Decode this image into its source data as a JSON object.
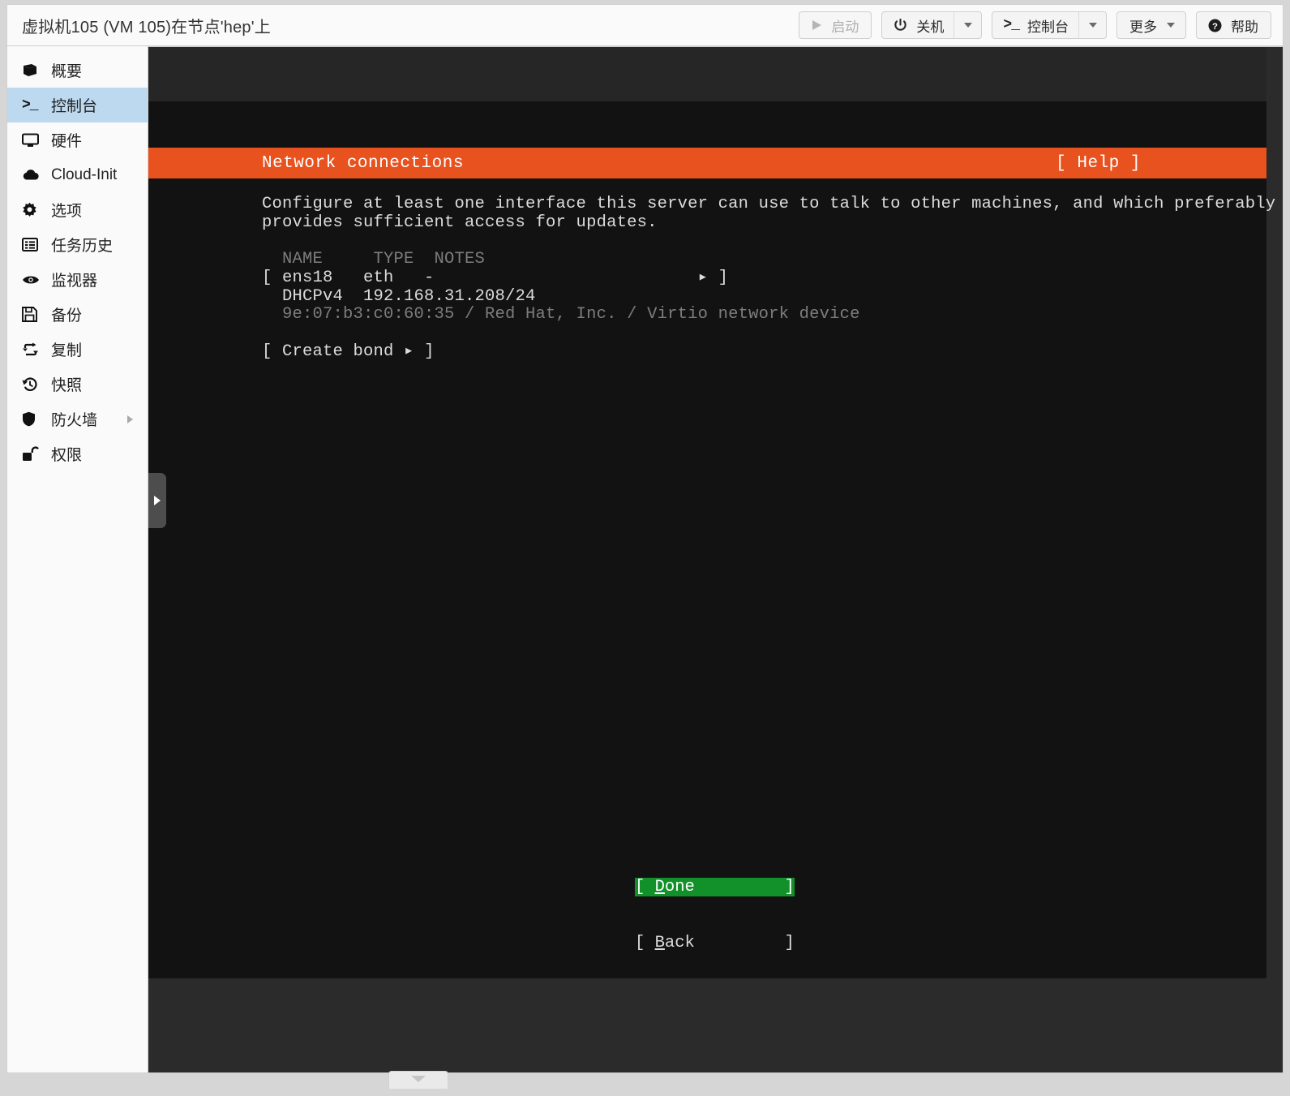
{
  "header": {
    "title": "虚拟机105 (VM 105)在节点'hep'上",
    "buttons": [
      {
        "label": "启动",
        "icon": "play-icon",
        "disabled": true,
        "dropdown": false
      },
      {
        "label": "关机",
        "icon": "power-icon",
        "disabled": false,
        "dropdown": true
      },
      {
        "label": "控制台",
        "icon": "terminal-prompt-icon",
        "disabled": false,
        "dropdown": true
      },
      {
        "label": "更多",
        "icon": "",
        "disabled": false,
        "dropdown": true,
        "plain_caret": true
      },
      {
        "label": "帮助",
        "icon": "question-circle-icon",
        "disabled": false,
        "dropdown": false
      }
    ]
  },
  "sidebar": {
    "items": [
      {
        "label": "概要",
        "icon": "book-icon",
        "active": false,
        "submenu": false
      },
      {
        "label": "控制台",
        "icon": "terminal-prompt-icon",
        "active": true,
        "submenu": false
      },
      {
        "label": "硬件",
        "icon": "monitor-icon",
        "active": false,
        "submenu": false
      },
      {
        "label": "Cloud-Init",
        "icon": "cloud-icon",
        "active": false,
        "submenu": false
      },
      {
        "label": "选项",
        "icon": "gear-icon",
        "active": false,
        "submenu": false
      },
      {
        "label": "任务历史",
        "icon": "list-icon",
        "active": false,
        "submenu": false
      },
      {
        "label": "监视器",
        "icon": "eye-icon",
        "active": false,
        "submenu": false
      },
      {
        "label": "备份",
        "icon": "floppy-disk-icon",
        "active": false,
        "submenu": false
      },
      {
        "label": "复制",
        "icon": "replicate-icon",
        "active": false,
        "submenu": false
      },
      {
        "label": "快照",
        "icon": "history-clock-icon",
        "active": false,
        "submenu": false
      },
      {
        "label": "防火墙",
        "icon": "shield-icon",
        "active": false,
        "submenu": true
      },
      {
        "label": "权限",
        "icon": "unlock-icon",
        "active": false,
        "submenu": false
      }
    ]
  },
  "console": {
    "installer": {
      "header_title": "Network connections",
      "header_help": "[ Help ]",
      "accent_color": "#e8521f",
      "background_color": "#121212",
      "text_color": "#dcdcdc",
      "dim_color": "#7d7d7d",
      "selection_color": "#12912b",
      "description_lines": [
        "Configure at least one interface this server can use to talk to other machines, and which preferably",
        "provides sufficient access for updates."
      ],
      "table_header": "  NAME     TYPE  NOTES",
      "interfaces": [
        {
          "row": "[ ens18   eth   -                          ▸ ]",
          "detail": "  DHCPv4  192.168.31.208/24",
          "hardware": "  9e:07:b3:c0:60:35 / Red Hat, Inc. / Virtio network device",
          "name": "ens18",
          "type": "eth",
          "notes": "-",
          "dhcp_version": "DHCPv4",
          "address": "192.168.31.208/24",
          "mac": "9e:07:b3:c0:60:35",
          "vendor": "Red Hat, Inc.",
          "model": "Virtio network device"
        }
      ],
      "create_bond": "[ Create bond ▸ ]",
      "buttons": [
        {
          "open": "[ ",
          "accel": "D",
          "rest": "one",
          "pad": "         ",
          "close": "]",
          "selected": true,
          "label": "Done"
        },
        {
          "open": "[ ",
          "accel": "B",
          "rest": "ack",
          "pad": "         ",
          "close": "]",
          "selected": false,
          "label": "Back"
        }
      ]
    }
  },
  "controls": {
    "left_drawer_handle": "expand-sidebar-handle",
    "bottom_drawer_handle": "collapse-panel-handle"
  }
}
